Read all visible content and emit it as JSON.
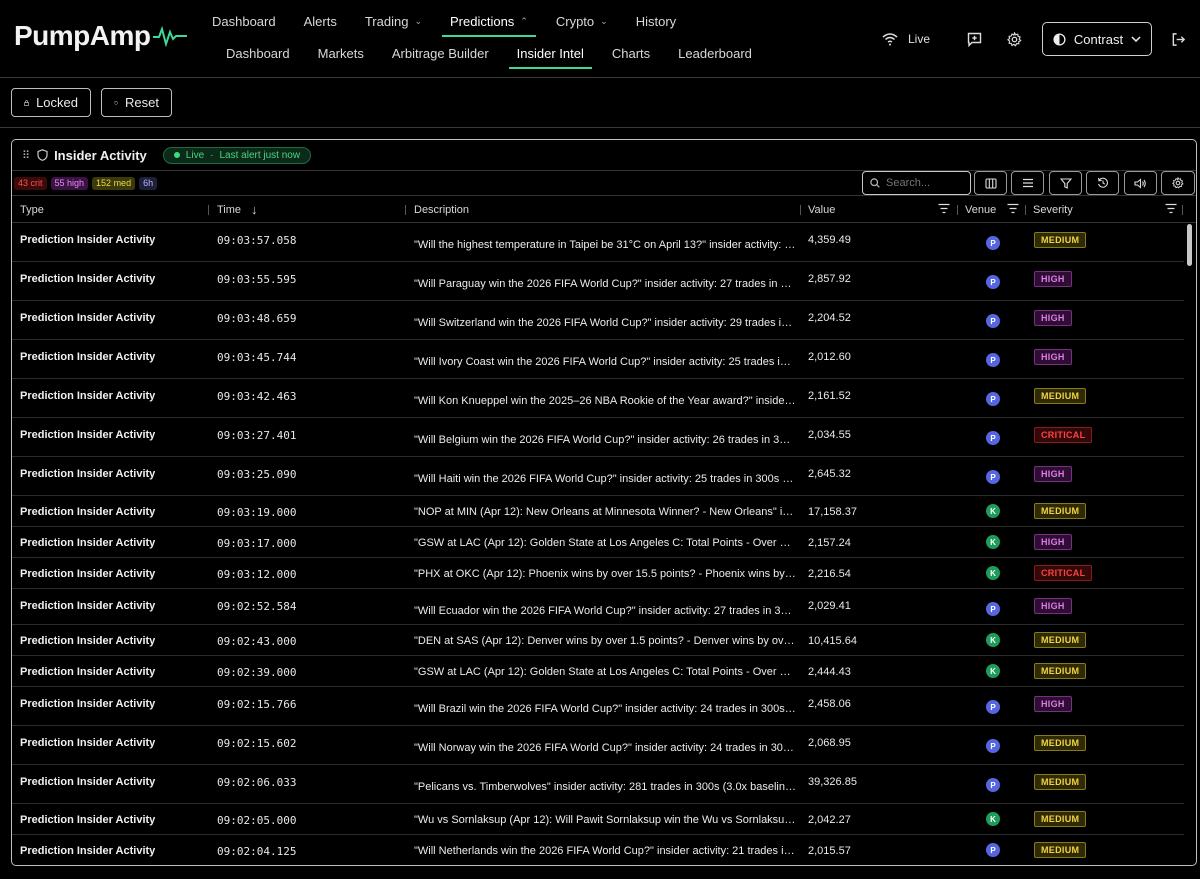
{
  "app": {
    "logo_text": "PumpAmp"
  },
  "nav": {
    "primary": [
      {
        "label": "Dashboard",
        "chevron": ""
      },
      {
        "label": "Alerts",
        "chevron": ""
      },
      {
        "label": "Trading",
        "chevron": "⌄"
      },
      {
        "label": "Predictions",
        "chevron": "⌃"
      },
      {
        "label": "Crypto",
        "chevron": "⌄"
      },
      {
        "label": "History",
        "chevron": ""
      }
    ],
    "secondary": [
      {
        "label": "Dashboard"
      },
      {
        "label": "Markets"
      },
      {
        "label": "Arbitrage Builder"
      },
      {
        "label": "Insider Intel"
      },
      {
        "label": "Charts"
      },
      {
        "label": "Leaderboard"
      }
    ],
    "active_primary": "Predictions",
    "active_secondary": "Insider Intel"
  },
  "header_right": {
    "live_label": "Live",
    "theme_label": "Contrast"
  },
  "toolbar": {
    "locked_label": "Locked",
    "reset_label": "Reset"
  },
  "panel": {
    "title": "Insider Activity",
    "live_label": "Live",
    "live_separator": "·",
    "last_alert": "Last alert just now",
    "chips": {
      "crit": "43 crit",
      "high": "55 high",
      "med": "152 med",
      "window": "6h"
    },
    "search_placeholder": "Search..."
  },
  "table": {
    "columns": {
      "type": "Type",
      "time": "Time",
      "description": "Description",
      "value": "Value",
      "venue": "Venue",
      "severity": "Severity"
    },
    "sort_indicator": "↓",
    "rows": [
      {
        "type": "Prediction Insider Activity",
        "time": "09:03:57.058",
        "description": "\"Will the highest temperature in Taipei be 31°C on April 13?\" insider activity: 1…",
        "value": "4,359.49",
        "venue": "P",
        "severity": "MEDIUM"
      },
      {
        "type": "Prediction Insider Activity",
        "time": "09:03:55.595",
        "description": "\"Will Paraguay win the 2026 FIFA World Cup?\" insider activity: 27 trades in 30…",
        "value": "2,857.92",
        "venue": "P",
        "severity": "HIGH"
      },
      {
        "type": "Prediction Insider Activity",
        "time": "09:03:48.659",
        "description": "\"Will Switzerland win the 2026 FIFA World Cup?\" insider activity: 29 trades in…",
        "value": "2,204.52",
        "venue": "P",
        "severity": "HIGH"
      },
      {
        "type": "Prediction Insider Activity",
        "time": "09:03:45.744",
        "description": "\"Will Ivory Coast win the 2026 FIFA World Cup?\" insider activity: 25 trades in …",
        "value": "2,012.60",
        "venue": "P",
        "severity": "HIGH"
      },
      {
        "type": "Prediction Insider Activity",
        "time": "09:03:42.463",
        "description": "\"Will Kon Knueppel win the 2025–26 NBA Rookie of the Year award?\" insider …",
        "value": "2,161.52",
        "venue": "P",
        "severity": "MEDIUM"
      },
      {
        "type": "Prediction Insider Activity",
        "time": "09:03:27.401",
        "description": "\"Will Belgium win the 2026 FIFA World Cup?\" insider activity: 26 trades in 30…",
        "value": "2,034.55",
        "venue": "P",
        "severity": "CRITICAL"
      },
      {
        "type": "Prediction Insider Activity",
        "time": "09:03:25.090",
        "description": "\"Will Haiti win the 2026 FIFA World Cup?\" insider activity: 25 trades in 300s (…",
        "value": "2,645.32",
        "venue": "P",
        "severity": "HIGH"
      },
      {
        "type": "Prediction Insider Activity",
        "time": "09:03:19.000",
        "description": "\"NOP at MIN (Apr 12): New Orleans at Minnesota Winner? - New Orleans\" ins…",
        "value": "17,158.37",
        "venue": "K",
        "severity": "MEDIUM"
      },
      {
        "type": "Prediction Insider Activity",
        "time": "09:03:17.000",
        "description": "\"GSW at LAC (Apr 12): Golden State at Los Angeles C: Total Points - Over 211…",
        "value": "2,157.24",
        "venue": "K",
        "severity": "HIGH"
      },
      {
        "type": "Prediction Insider Activity",
        "time": "09:03:12.000",
        "description": "\"PHX at OKC (Apr 12): Phoenix wins by over 15.5 points? - Phoenix wins by o…",
        "value": "2,216.54",
        "venue": "K",
        "severity": "CRITICAL"
      },
      {
        "type": "Prediction Insider Activity",
        "time": "09:02:52.584",
        "description": "\"Will Ecuador win the 2026 FIFA World Cup?\" insider activity: 27 trades in 30…",
        "value": "2,029.41",
        "venue": "P",
        "severity": "HIGH"
      },
      {
        "type": "Prediction Insider Activity",
        "time": "09:02:43.000",
        "description": "\"DEN at SAS (Apr 12): Denver wins by over 1.5 points? - Denver wins by over …",
        "value": "10,415.64",
        "venue": "K",
        "severity": "MEDIUM"
      },
      {
        "type": "Prediction Insider Activity",
        "time": "09:02:39.000",
        "description": "\"GSW at LAC (Apr 12): Golden State at Los Angeles C: Total Points - Over 214…",
        "value": "2,444.43",
        "venue": "K",
        "severity": "MEDIUM"
      },
      {
        "type": "Prediction Insider Activity",
        "time": "09:02:15.766",
        "description": "\"Will Brazil win the 2026 FIFA World Cup?\" insider activity: 24 trades in 300s …",
        "value": "2,458.06",
        "venue": "P",
        "severity": "HIGH"
      },
      {
        "type": "Prediction Insider Activity",
        "time": "09:02:15.602",
        "description": "\"Will Norway win the 2026 FIFA World Cup?\" insider activity: 24 trades in 30…",
        "value": "2,068.95",
        "venue": "P",
        "severity": "MEDIUM"
      },
      {
        "type": "Prediction Insider Activity",
        "time": "09:02:06.033",
        "description": "\"Pelicans vs. Timberwolves\" insider activity: 281 trades in 300s (3.0x baselin…",
        "value": "39,326.85",
        "venue": "P",
        "severity": "MEDIUM"
      },
      {
        "type": "Prediction Insider Activity",
        "time": "09:02:05.000",
        "description": "\"Wu vs Sornlaksup (Apr 12): Will Pawit Sornlaksup win the Wu vs Sornlaksup: …",
        "value": "2,042.27",
        "venue": "K",
        "severity": "MEDIUM"
      },
      {
        "type": "Prediction Insider Activity",
        "time": "09:02:04.125",
        "description": "\"Will Netherlands win the 2026 FIFA World Cup?\" insider activity: 21 trades in…",
        "value": "2,015.57",
        "venue": "P",
        "severity": "MEDIUM"
      }
    ]
  }
}
